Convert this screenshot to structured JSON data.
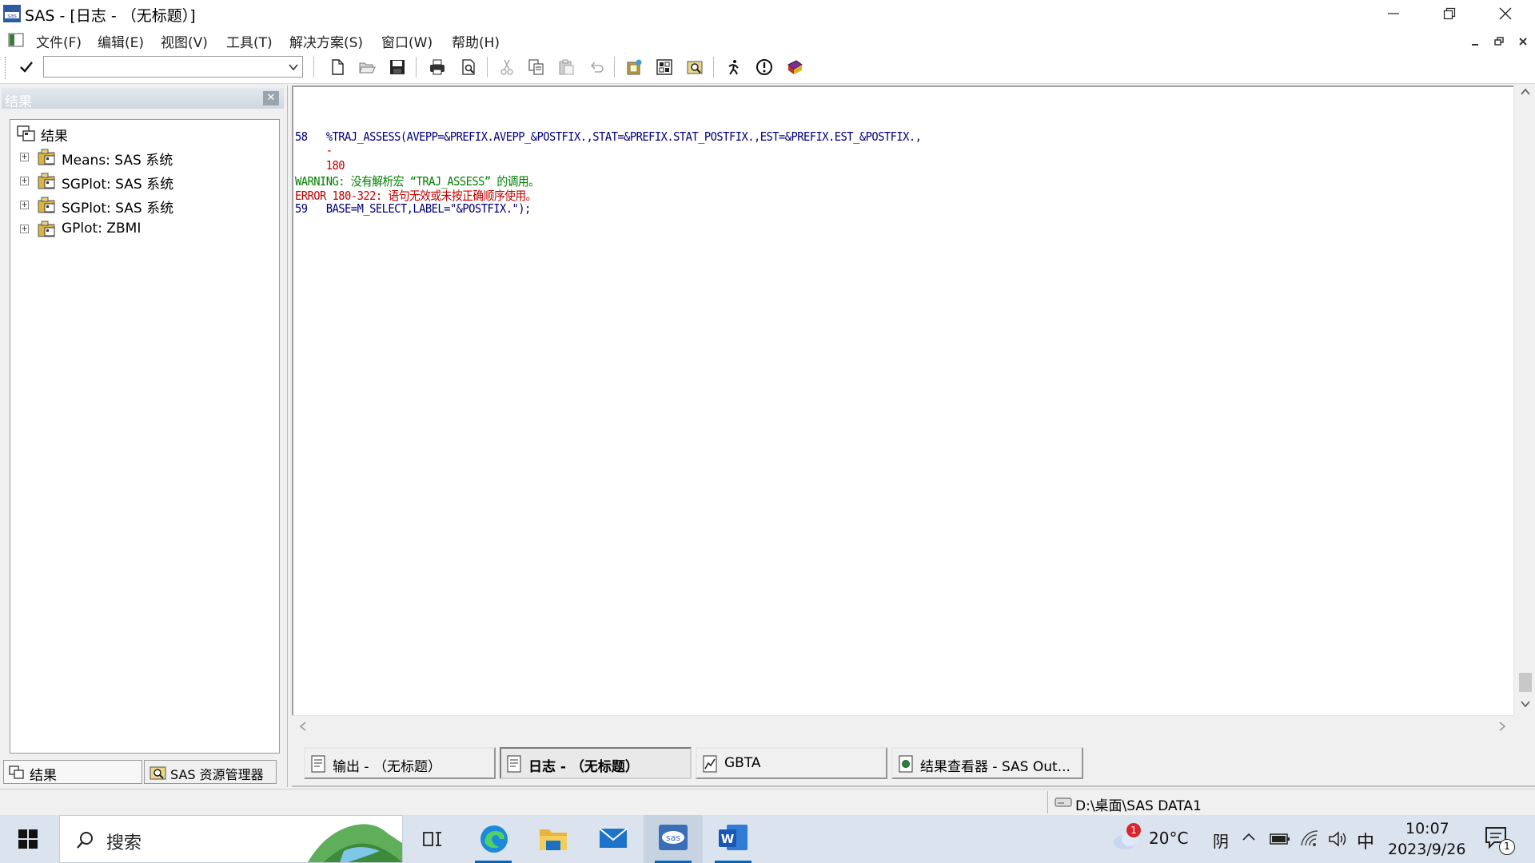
{
  "window": {
    "title": "SAS - [日志 - （无标题）]",
    "controls": [
      "minimize",
      "restore",
      "close"
    ]
  },
  "menu": [
    "文件(F)",
    "编辑(E)",
    "视图(V)",
    "工具(T)",
    "解决方案(S)",
    "窗口(W)",
    "帮助(H)"
  ],
  "toolbar": {
    "command_value": "",
    "buttons": [
      "new-icon",
      "open-icon",
      "save-icon",
      "print-icon",
      "print-preview-icon",
      "cut-icon",
      "copy-icon",
      "paste-icon",
      "undo-icon",
      "new-library-icon",
      "explorer-icon",
      "results-search-icon",
      "run-icon",
      "break-icon",
      "help-book-icon"
    ]
  },
  "results": {
    "header": "结果",
    "root_label": "结果",
    "nodes": [
      {
        "label": "Means:  SAS 系统"
      },
      {
        "label": "SGPlot:  SAS 系统"
      },
      {
        "label": "SGPlot:  SAS 系统"
      },
      {
        "label": "GPlot:  ZBMI"
      }
    ],
    "tabs": [
      "结果",
      "SAS 资源管理器"
    ]
  },
  "log": {
    "lines": [
      {
        "type": "normal",
        "text": "58   %TRAJ_ASSESS(AVEPP=&PREFIX.AVEPP_&POSTFIX.,STAT=&PREFIX.STAT_POSTFIX.,EST=&PREFIX.EST_&POSTFIX.,"
      },
      {
        "type": "error-marker",
        "text": "     -"
      },
      {
        "type": "error-marker",
        "text": "     180"
      },
      {
        "type": "warning",
        "text": "WARNING: 没有解析宏 “TRAJ_ASSESS” 的调用。"
      },
      {
        "type": "error",
        "text": "ERROR 180-322: 语句无效或未按正确顺序使用。"
      },
      {
        "type": "normal",
        "text": "59   BASE=M_SELECT,LABEL=\"&POSTFIX.\");"
      }
    ]
  },
  "window_tabs": [
    {
      "label": "输出 - （无标题）",
      "active": false
    },
    {
      "label": "日志 - （无标题）",
      "active": true
    },
    {
      "label": "GBTA",
      "active": false
    },
    {
      "label": "结果查看器 - SAS Out...",
      "active": false
    }
  ],
  "status": {
    "path": "D:\\桌面\\SAS DATA1"
  },
  "taskbar": {
    "search_placeholder": "搜索",
    "apps": [
      "task-view-icon",
      "edge-icon",
      "file-explorer-icon",
      "mail-icon",
      "sas-icon",
      "word-icon"
    ],
    "weather": {
      "temp": "20°C",
      "condition": "阴",
      "badge": "1"
    },
    "ime": "中",
    "time": "10:07",
    "date": "2023/9/26",
    "notification_count": "1"
  },
  "colors": {
    "log_normal": "#00007e",
    "log_warning": "#008000",
    "log_error": "#c00000",
    "taskbar_bg": "#dbe3ee",
    "accent": "#0067c0"
  }
}
